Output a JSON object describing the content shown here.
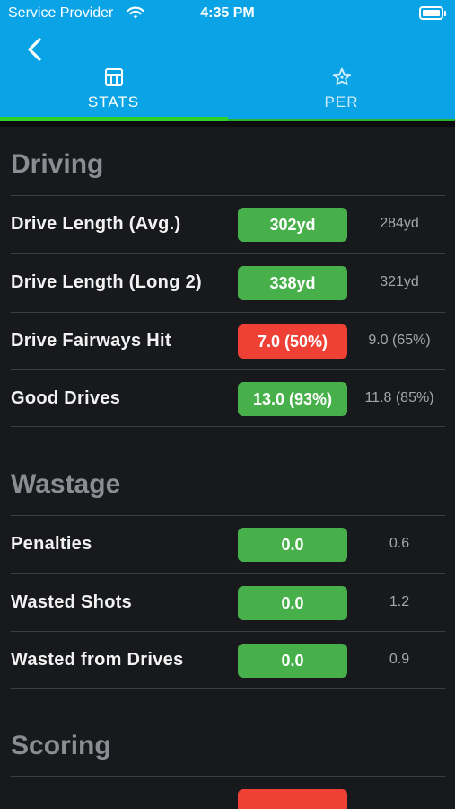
{
  "status_bar": {
    "carrier": "Service Provider",
    "time": "4:35 PM"
  },
  "nav": {
    "tabs": [
      {
        "label": "STATS",
        "icon": "table-icon",
        "active": true
      },
      {
        "label": "PER",
        "icon": "star-icon",
        "active": false
      }
    ]
  },
  "colors": {
    "header": "#0aa4e6",
    "active_indicator": "#2ed12a",
    "good": "#47b04b",
    "bad": "#ef4036",
    "background": "#17191c"
  },
  "sections": [
    {
      "title": "Driving",
      "rows": [
        {
          "label": "Drive Length (Avg.)",
          "value": "302yd",
          "status": "good",
          "compare": "284yd"
        },
        {
          "label": "Drive Length (Long 2)",
          "value": "338yd",
          "status": "good",
          "compare": "321yd"
        },
        {
          "label": "Drive Fairways Hit",
          "value": "7.0 (50%)",
          "status": "bad",
          "compare": "9.0 (65%)"
        },
        {
          "label": "Good Drives",
          "value": "13.0 (93%)",
          "status": "good",
          "compare": "11.8 (85%)"
        }
      ]
    },
    {
      "title": "Wastage",
      "rows": [
        {
          "label": "Penalties",
          "value": "0.0",
          "status": "good",
          "compare": "0.6"
        },
        {
          "label": "Wasted Shots",
          "value": "0.0",
          "status": "good",
          "compare": "1.2"
        },
        {
          "label": "Wasted from Drives",
          "value": "0.0",
          "status": "good",
          "compare": "0.9"
        }
      ]
    },
    {
      "title": "Scoring",
      "rows": []
    }
  ]
}
